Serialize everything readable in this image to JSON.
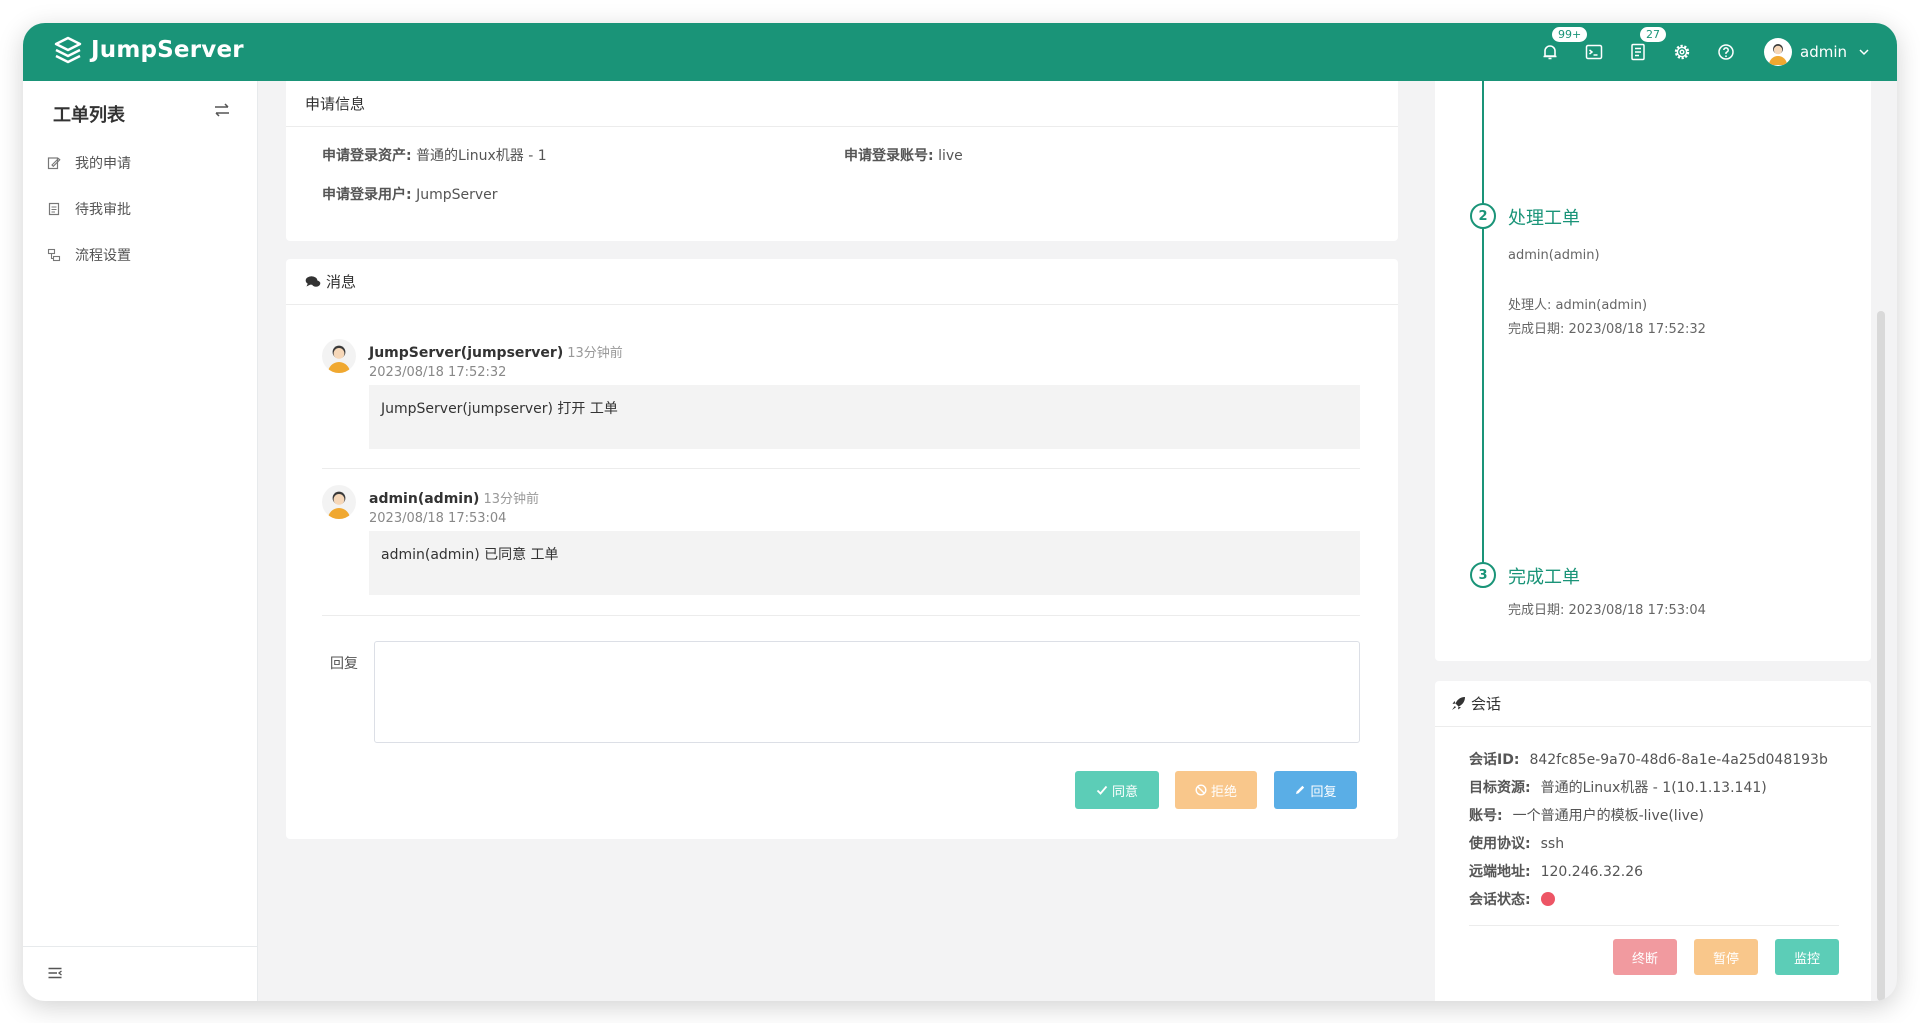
{
  "header": {
    "brand": "JumpServer",
    "notifications_badge": "99+",
    "tickets_badge": "27",
    "username": "admin"
  },
  "sidebar": {
    "title": "工单列表",
    "items": [
      {
        "label": "我的申请",
        "icon": "edit-icon"
      },
      {
        "label": "待我审批",
        "icon": "file-icon"
      },
      {
        "label": "流程设置",
        "icon": "flow-icon"
      }
    ]
  },
  "apply_info": {
    "title": "申请信息",
    "asset_label": "申请登录资产:",
    "asset_value": "普通的Linux机器 - 1",
    "account_label": "申请登录账号:",
    "account_value": "live",
    "user_label": "申请登录用户:",
    "user_value": "JumpServer"
  },
  "messages": {
    "title": "消息",
    "items": [
      {
        "author": "JumpServer(jumpserver)",
        "ago": "13分钟前",
        "date": "2023/08/18 17:52:32",
        "text": "JumpServer(jumpserver) 打开 工单"
      },
      {
        "author": "admin(admin)",
        "ago": "13分钟前",
        "date": "2023/08/18 17:53:04",
        "text": "admin(admin) 已同意 工单"
      }
    ],
    "reply_label": "回复",
    "reply_value": "",
    "approve_label": "同意",
    "reject_label": "拒绝",
    "reply_button_label": "回复"
  },
  "timeline": {
    "steps": [
      {
        "num": "2",
        "title": "处理工单",
        "lines": [
          "admin(admin)",
          "处理人: admin(admin)",
          "完成日期: 2023/08/18 17:52:32"
        ]
      },
      {
        "num": "3",
        "title": "完成工单",
        "lines": [
          "完成日期: 2023/08/18 17:53:04"
        ]
      }
    ]
  },
  "session": {
    "title": "会话",
    "rows": [
      {
        "label": "会话ID:",
        "value": "842fc85e-9a70-48d6-8a1e-4a25d048193b"
      },
      {
        "label": "目标资源:",
        "value": "普通的Linux机器 - 1(10.1.13.141)"
      },
      {
        "label": "账号:",
        "value": "一个普通用户的模板-live(live)"
      },
      {
        "label": "使用协议:",
        "value": "ssh"
      },
      {
        "label": "远端地址:",
        "value": "120.246.32.26"
      },
      {
        "label": "会话状态:",
        "value": ""
      }
    ],
    "status_color": "#ed5565",
    "terminate_label": "终断",
    "pause_label": "暂停",
    "monitor_label": "监控"
  },
  "colors": {
    "brand": "#1a9478",
    "approve": "#5ccdb7",
    "reject": "#f9c78b",
    "reply": "#5aaee6",
    "terminate": "#f19a9f",
    "pause": "#f9c78b",
    "monitor": "#5ccdb7"
  }
}
